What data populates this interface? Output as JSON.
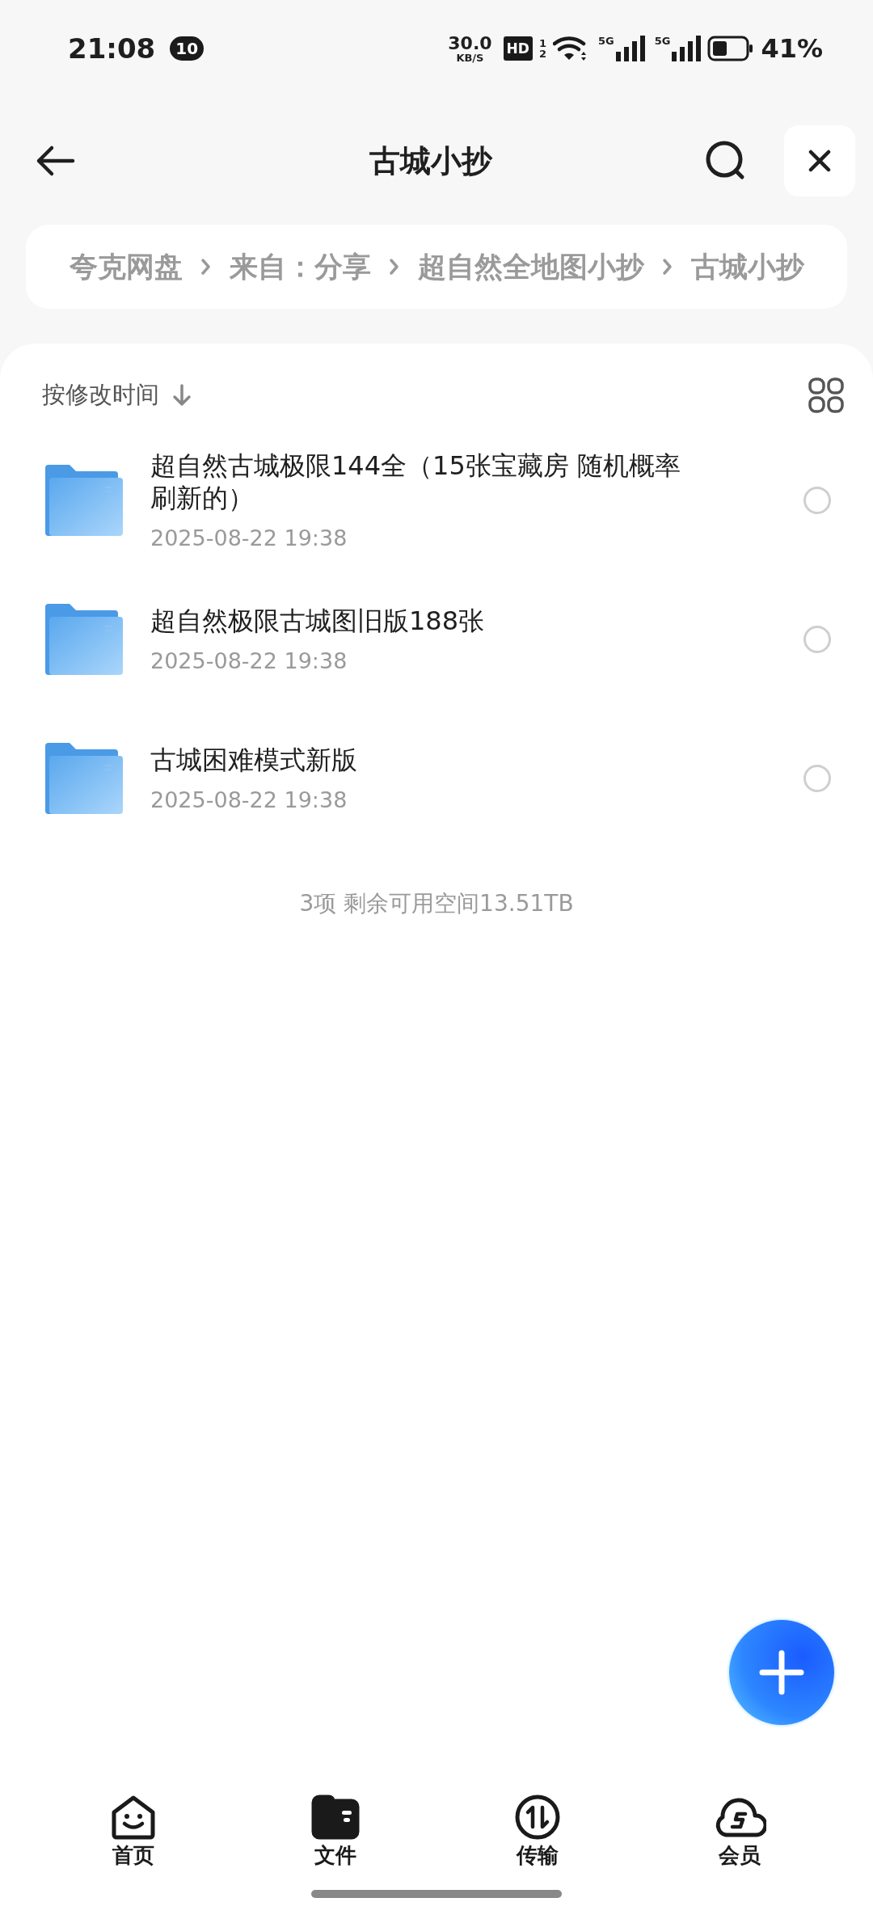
{
  "status_bar": {
    "time": "21:08",
    "notification_count": "10",
    "speed": "30.0",
    "speed_unit": "KB/S",
    "hd_label": "HD",
    "hd_sims": [
      "1",
      "2"
    ],
    "network_labels": [
      "5G",
      "5G"
    ],
    "battery": "41%"
  },
  "header": {
    "title": "古城小抄"
  },
  "breadcrumb": [
    "夸克网盘",
    "来自：分享",
    "超自然全地图小抄",
    "古城小抄"
  ],
  "sort": {
    "label": "按修改时间"
  },
  "files": [
    {
      "name": "超自然古城极限144全（15张宝藏房 随机概率刷新的）",
      "date": "2025-08-22 19:38",
      "checked": false
    },
    {
      "name": "超自然极限古城图旧版188张",
      "date": "2025-08-22 19:38",
      "checked": false
    },
    {
      "name": "古城困难模式新版",
      "date": "2025-08-22 19:38",
      "checked": false
    }
  ],
  "summary": "3项 剩余可用空间13.51TB",
  "nav": [
    {
      "kind": "home",
      "label": "首页",
      "selected": false
    },
    {
      "kind": "files",
      "label": "文件",
      "selected": true
    },
    {
      "kind": "transfer",
      "label": "传输",
      "selected": false
    },
    {
      "kind": "member",
      "label": "会员",
      "selected": false
    }
  ]
}
